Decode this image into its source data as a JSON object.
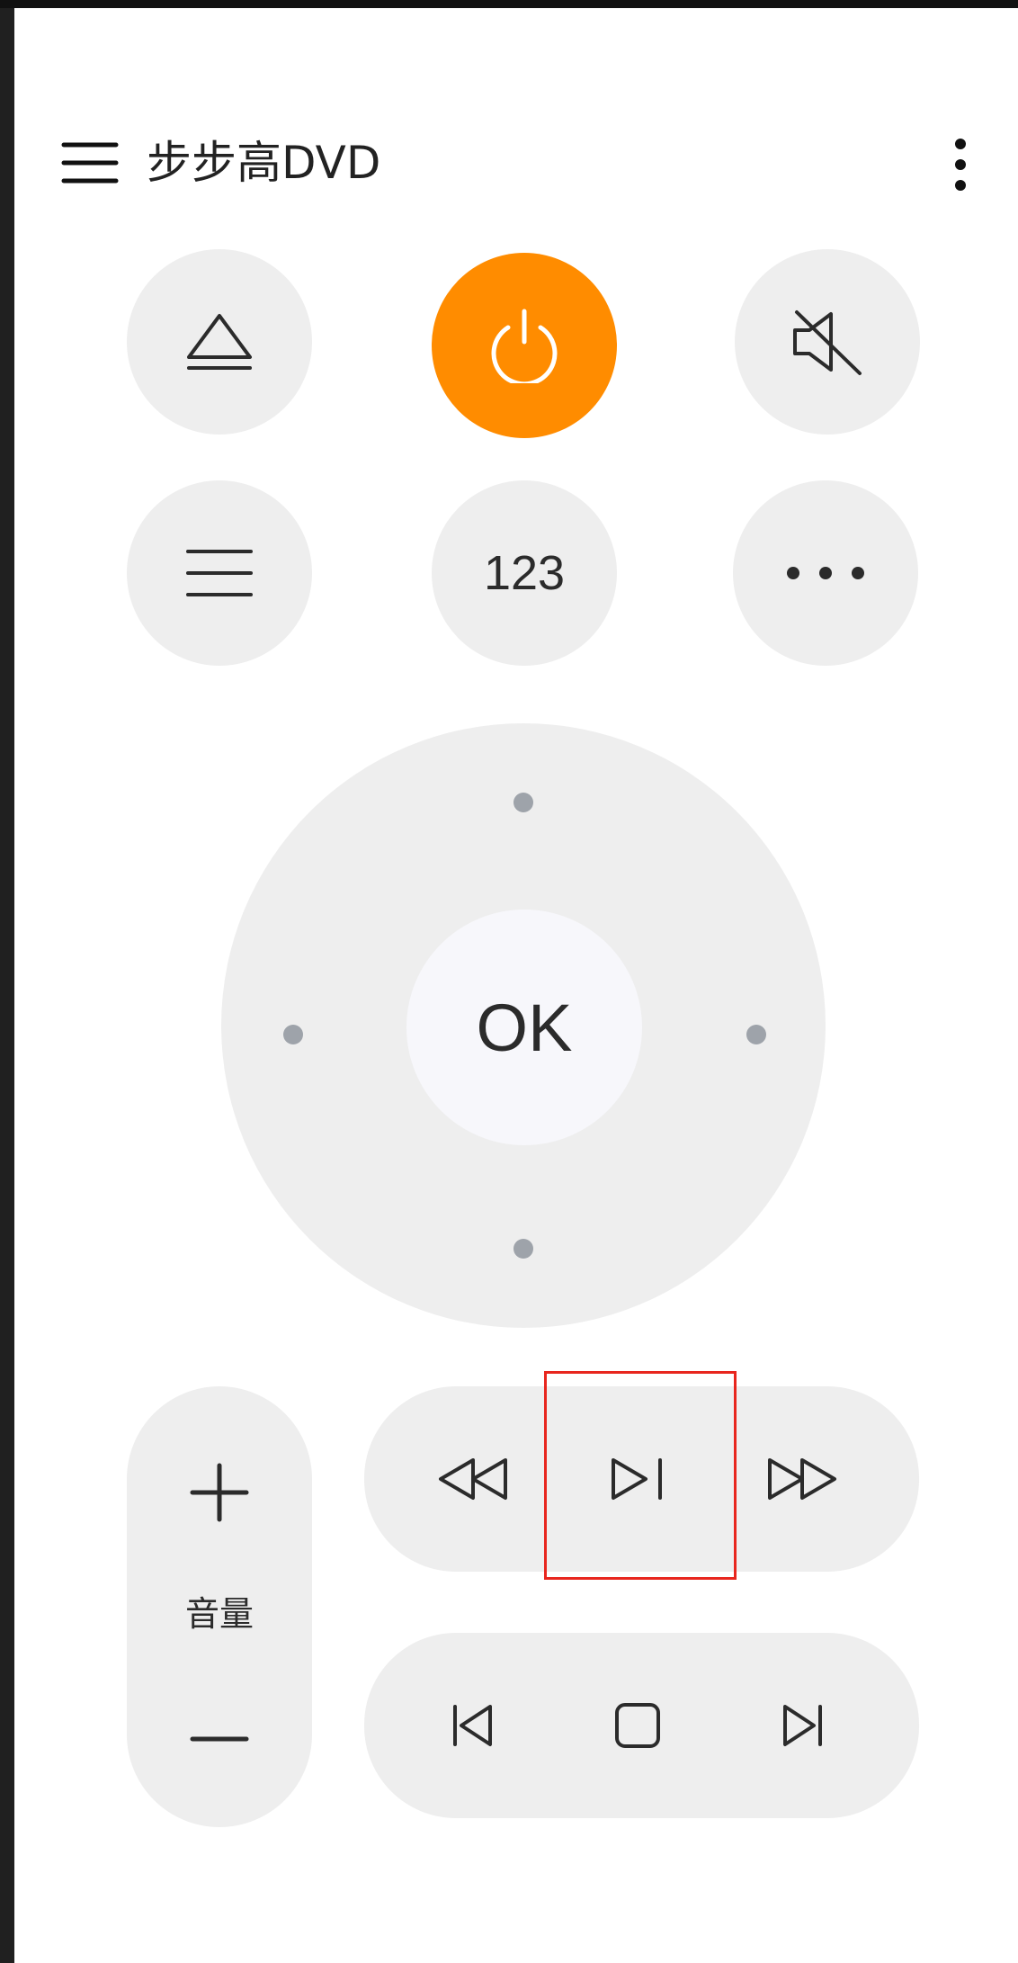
{
  "header": {
    "title": "步步高DVD",
    "menu_icon": "hamburger-menu-icon",
    "overflow_icon": "more-vert-icon"
  },
  "top_row": {
    "eject_icon": "eject-icon",
    "power_icon": "power-icon",
    "mute_icon": "volume-mute-icon"
  },
  "second_row": {
    "menu_icon": "menu-lines-icon",
    "numbers_label": "123",
    "more_icon": "more-horiz-icon"
  },
  "dpad": {
    "ok_label": "OK"
  },
  "volume": {
    "label": "音量",
    "plus_icon": "plus-icon",
    "minus_icon": "minus-icon"
  },
  "playback": {
    "rewind_icon": "rewind-icon",
    "play_pause_icon": "play-pause-icon",
    "fast_forward_icon": "fast-forward-icon",
    "previous_icon": "skip-previous-icon",
    "stop_icon": "stop-icon",
    "next_icon": "skip-next-icon"
  },
  "colors": {
    "accent": "#ff8c00",
    "button_bg": "#eeeeee",
    "ok_bg": "#f7f7fb",
    "dot": "#9ea3aa",
    "highlight": "#e8261e",
    "icon": "#2b2b2b"
  }
}
